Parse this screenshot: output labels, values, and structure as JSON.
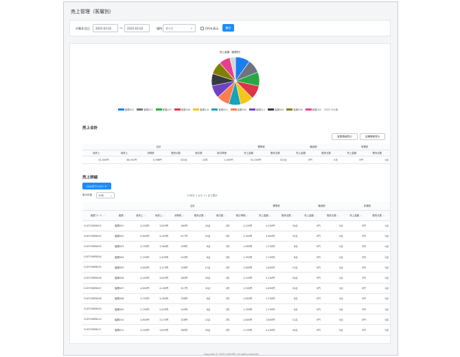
{
  "page": {
    "title": "売上管理（客層別）"
  },
  "filter": {
    "period_label": "対象年月日",
    "date_from": "2025-03-02",
    "tilde": "〜",
    "date_to": "2025-03-02",
    "store_label": "場所",
    "store_value": "すべて",
    "zero_label": "0円を表示",
    "submit_label": "集計"
  },
  "chart": {
    "title": "売上金額（客層別）",
    "chart_data": {
      "type": "pie",
      "title": "売上金額（客層別）",
      "categories": [
        "客層001",
        "客層007",
        "客層007",
        "客層006",
        "客層010",
        "客層003",
        "客層009",
        "客層011",
        "客層004",
        "客層008",
        "客層002",
        "その他"
      ],
      "values": [
        9.8,
        9.2,
        9.4,
        9.2,
        8.9,
        8.1,
        8.6,
        8.6,
        8.2,
        8.6,
        7.6,
        3.8
      ],
      "colors": [
        "#1a7ef0",
        "#6c757d",
        "#28a745",
        "#dc3545",
        "#f5c518",
        "#17a2b8",
        "#fd7e4f",
        "#6f42c1",
        "#343a40",
        "#808000",
        "#e83e8c",
        "#d6d6d6"
      ]
    }
  },
  "summary": {
    "section_title": "売上合計",
    "btn_customer": "客層情報表示",
    "btn_store": "店舗情報表示",
    "group_headers": [
      "合計",
      "標準税",
      "軽減税",
      "非課税"
    ],
    "headers": [
      "総売上",
      "純売上",
      "消費税",
      "販売点数",
      "取引数",
      "取引単価",
      "売上金額",
      "販売点数",
      "売上金額",
      "販売点数",
      "売上金額",
      "販売点数"
    ],
    "values": [
      "41,000円",
      "38,001円",
      "3,766円",
      "322点",
      "22件",
      "1,000円",
      "41,000円",
      "322点",
      "0円",
      "0点",
      "0円",
      "0点"
    ]
  },
  "detail": {
    "section_title": "売上詳細",
    "csv_label": "CSVダウンロード",
    "page_size_label": "表示件数",
    "page_size_value": "10件",
    "page_info": "11件中 1 から 11 まで表示",
    "group_headers": [
      "合計",
      "標準税",
      "軽減税",
      "非課税"
    ],
    "headers": [
      "客層コード",
      "客層",
      "総売上",
      "純売上",
      "消費税",
      "販売点数",
      "取引数",
      "取引単価",
      "売上金額",
      "販売点数",
      "売上金額",
      "販売点数",
      "売上金額",
      "販売点数"
    ],
    "rows": [
      [
        "CUSTOMER001",
        "客層001",
        "4,200円",
        "3,820円",
        "380円",
        "34点",
        "2件",
        "2,100円",
        "4,200円",
        "34点",
        "0円",
        "0点",
        "0円",
        "0点"
      ],
      [
        "CUSTOMER002",
        "客層002",
        "4,600円",
        "4,183円",
        "417円",
        "32点",
        "2件",
        "2,300円",
        "4,600円",
        "32点",
        "0円",
        "0点",
        "0円",
        "0点"
      ],
      [
        "CUSTOMER003",
        "客層003",
        "3,700円",
        "3,364円",
        "336円",
        "8点",
        "2件",
        "1,850円",
        "3,700円",
        "8点",
        "0円",
        "0点",
        "0円",
        "0点"
      ],
      [
        "CUSTOMER004",
        "客層004",
        "2,700円",
        "2,455円",
        "245円",
        "8点",
        "2件",
        "1,350円",
        "2,700円",
        "8点",
        "0円",
        "0点",
        "0円",
        "0点"
      ],
      [
        "CUSTOMER005",
        "客層005",
        "3,600円",
        "3,274円",
        "326円",
        "12点",
        "2件",
        "1,800円",
        "3,600円",
        "12点",
        "0円",
        "0点",
        "0円",
        "0点"
      ],
      [
        "CUSTOMER006",
        "客層006",
        "4,200円",
        "3,820円",
        "380円",
        "34点",
        "2件",
        "2,100円",
        "4,200円",
        "34点",
        "0円",
        "0点",
        "0円",
        "0点"
      ],
      [
        "CUSTOMER007",
        "客層007",
        "4,600円",
        "4,183円",
        "417円",
        "32点",
        "2件",
        "2,300円",
        "4,600円",
        "32点",
        "0円",
        "0点",
        "0円",
        "0点"
      ],
      [
        "CUSTOMER008",
        "客層008",
        "3,700円",
        "3,364円",
        "336円",
        "8点",
        "2件",
        "1,850円",
        "3,700円",
        "8点",
        "0円",
        "0点",
        "0円",
        "0点"
      ],
      [
        "CUSTOMER009",
        "客層009",
        "2,700円",
        "2,455円",
        "245円",
        "8点",
        "2件",
        "1,350円",
        "2,700円",
        "8点",
        "0円",
        "0点",
        "0円",
        "0点"
      ],
      [
        "CUSTOMER010",
        "客層010",
        "3,600円",
        "3,274円",
        "326円",
        "12点",
        "2件",
        "1,800円",
        "3,600円",
        "12点",
        "0円",
        "0点",
        "0円",
        "0点"
      ],
      [
        "CUSTOMER011",
        "客層011",
        "4,200円",
        "3,820円",
        "380円",
        "34点",
        "2件",
        "2,100円",
        "4,200円",
        "34点",
        "0円",
        "0点",
        "0円",
        "0点"
      ]
    ]
  },
  "footer": {
    "copyright": "Copyright © 2025 CASHIER. All rights reserved."
  }
}
